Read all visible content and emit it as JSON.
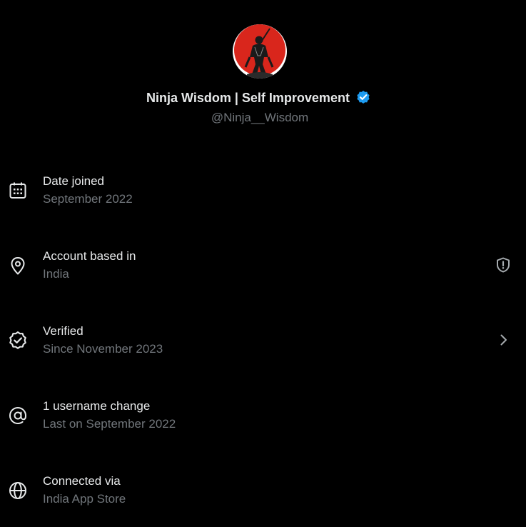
{
  "profile": {
    "display_name": "Ninja Wisdom | Self Improvement",
    "handle": "@Ninja__Wisdom",
    "avatar_icon": "ninja-avatar",
    "verified_icon": "verified-badge-icon",
    "verified_color": "#1d9bf0",
    "avatar_bg_color": "#d9261c"
  },
  "about": {
    "items": [
      {
        "icon": "calendar-icon",
        "title": "Date joined",
        "subtitle": "September 2022",
        "trailing": null
      },
      {
        "icon": "location-pin-icon",
        "title": "Account based in",
        "subtitle": "India",
        "trailing": "shield-alert-icon"
      },
      {
        "icon": "verified-check-icon",
        "title": "Verified",
        "subtitle": "Since November 2023",
        "trailing": "chevron-right-icon"
      },
      {
        "icon": "at-sign-icon",
        "title": "1 username change",
        "subtitle": "Last on September 2022",
        "trailing": null
      },
      {
        "icon": "globe-icon",
        "title": "Connected via",
        "subtitle": "India App Store",
        "trailing": null
      }
    ]
  },
  "colors": {
    "background": "#000000",
    "primary_text": "#e7e9ea",
    "secondary_text": "#71767b"
  }
}
